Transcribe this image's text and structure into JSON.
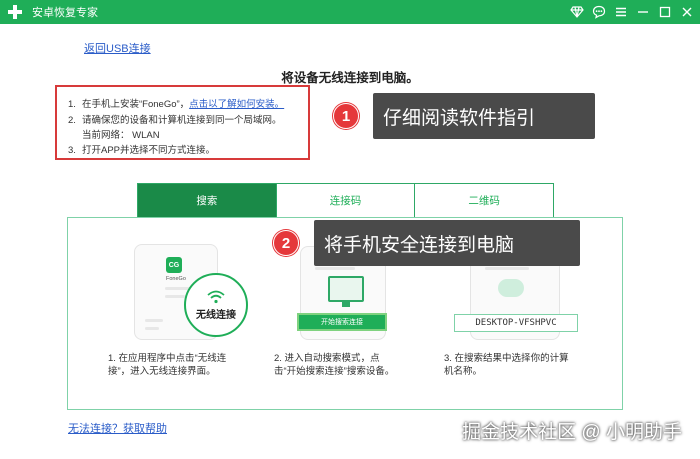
{
  "app": {
    "title": "安卓恢复专家"
  },
  "back_link": "返回USB连接",
  "heading": "将设备无线连接到电脑。",
  "instructions": [
    {
      "num": "1.",
      "text": "在手机上安装“FoneGo”，",
      "link": "点击以了解如何安装。"
    },
    {
      "num": "2.",
      "text": "请确保您的设备和计算机连接到同一个局域网。"
    },
    {
      "num": "",
      "text": "当前网络：  WLAN"
    },
    {
      "num": "3.",
      "text": "打开APP并选择不同方式连接。"
    }
  ],
  "callouts": [
    {
      "badge": "1",
      "text": "仔细阅读软件指引"
    },
    {
      "badge": "2",
      "text": "将手机安全连接到电脑"
    }
  ],
  "tabs": [
    {
      "label": "搜索",
      "active": true
    },
    {
      "label": "连接码",
      "active": false
    },
    {
      "label": "二维码",
      "active": false
    }
  ],
  "illustrations": {
    "app_logo": "CG",
    "app_name": "FoneGo",
    "wifi_label": "无线连接",
    "start_button": "开始搜索连接",
    "device_name": "DESKTOP-VFSHPVC"
  },
  "steps": [
    {
      "line1": "1.  在应用程序中点击“无线连",
      "line2": "接”，进入无线连接界面。"
    },
    {
      "line1": "2.  进入自动搜索模式，点",
      "line2": "击“开始搜索连接”搜索设备。"
    },
    {
      "line1": "3.  在搜索结果中选择你的计算",
      "line2": "机名称。"
    }
  ],
  "help_link": "无法连接？获取帮助",
  "watermark": "掘金技术社区 @ 小明助手",
  "colors": {
    "brand": "#1fae58",
    "active_tab": "#1a8a48",
    "highlight": "#d73a3a",
    "link": "#2a5cc8"
  }
}
